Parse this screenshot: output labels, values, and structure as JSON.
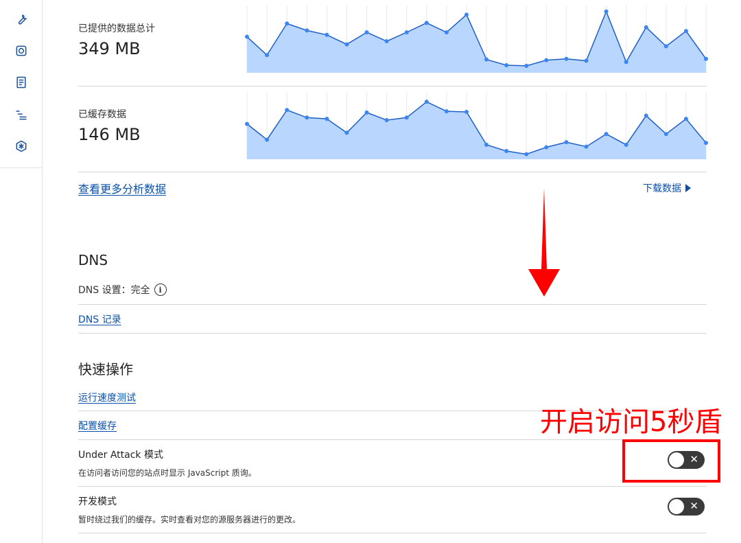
{
  "sidebar": {
    "icons": [
      "wrench-icon",
      "camera-icon",
      "document-icon",
      "list-icon",
      "network-icon"
    ]
  },
  "stats": [
    {
      "label": "已提供的数据总计",
      "value": "349 MB",
      "sparkline": [
        57,
        28,
        78,
        67,
        60,
        45,
        64,
        50,
        64,
        79,
        64,
        92,
        21,
        12,
        11,
        20,
        22,
        19,
        97,
        17,
        72,
        42,
        66,
        22
      ]
    },
    {
      "label": "已缓存数据",
      "value": "146 MB",
      "sparkline": [
        56,
        31,
        78,
        66,
        64,
        42,
        74,
        62,
        66,
        91,
        76,
        75,
        23,
        13,
        8,
        19,
        27,
        20,
        40,
        23,
        69,
        40,
        64,
        26
      ]
    }
  ],
  "analytics": {
    "more_link": "查看更多分析数据",
    "download_label": "下载数据"
  },
  "dns": {
    "title": "DNS",
    "setting": "DNS 设置：完全",
    "info_glyph": "i",
    "records_link": "DNS 记录"
  },
  "quick_actions": {
    "title": "快速操作",
    "speed_test": "运行速度测试",
    "configure_cache": "配置缓存",
    "under_attack": {
      "title": "Under Attack 模式",
      "description": "在访问者访问您的站点时显示 JavaScript 质询。",
      "enabled": false
    },
    "dev_mode": {
      "title": "开发模式",
      "description": "暂时绕过我们的缓存。实时查看对您的源服务器进行的更改。",
      "enabled": false
    },
    "toggle_off_glyph": "✕"
  },
  "annotation": {
    "text": "开启访问5秒盾",
    "color": "#ff0000"
  },
  "colors": {
    "link": "#0a4fa8",
    "sparkline_fill": "#b9d6ff",
    "sparkline_line": "#1f5fc4",
    "sparkline_point": "#3b86f0",
    "toggle_off": "#3a3a3a"
  }
}
